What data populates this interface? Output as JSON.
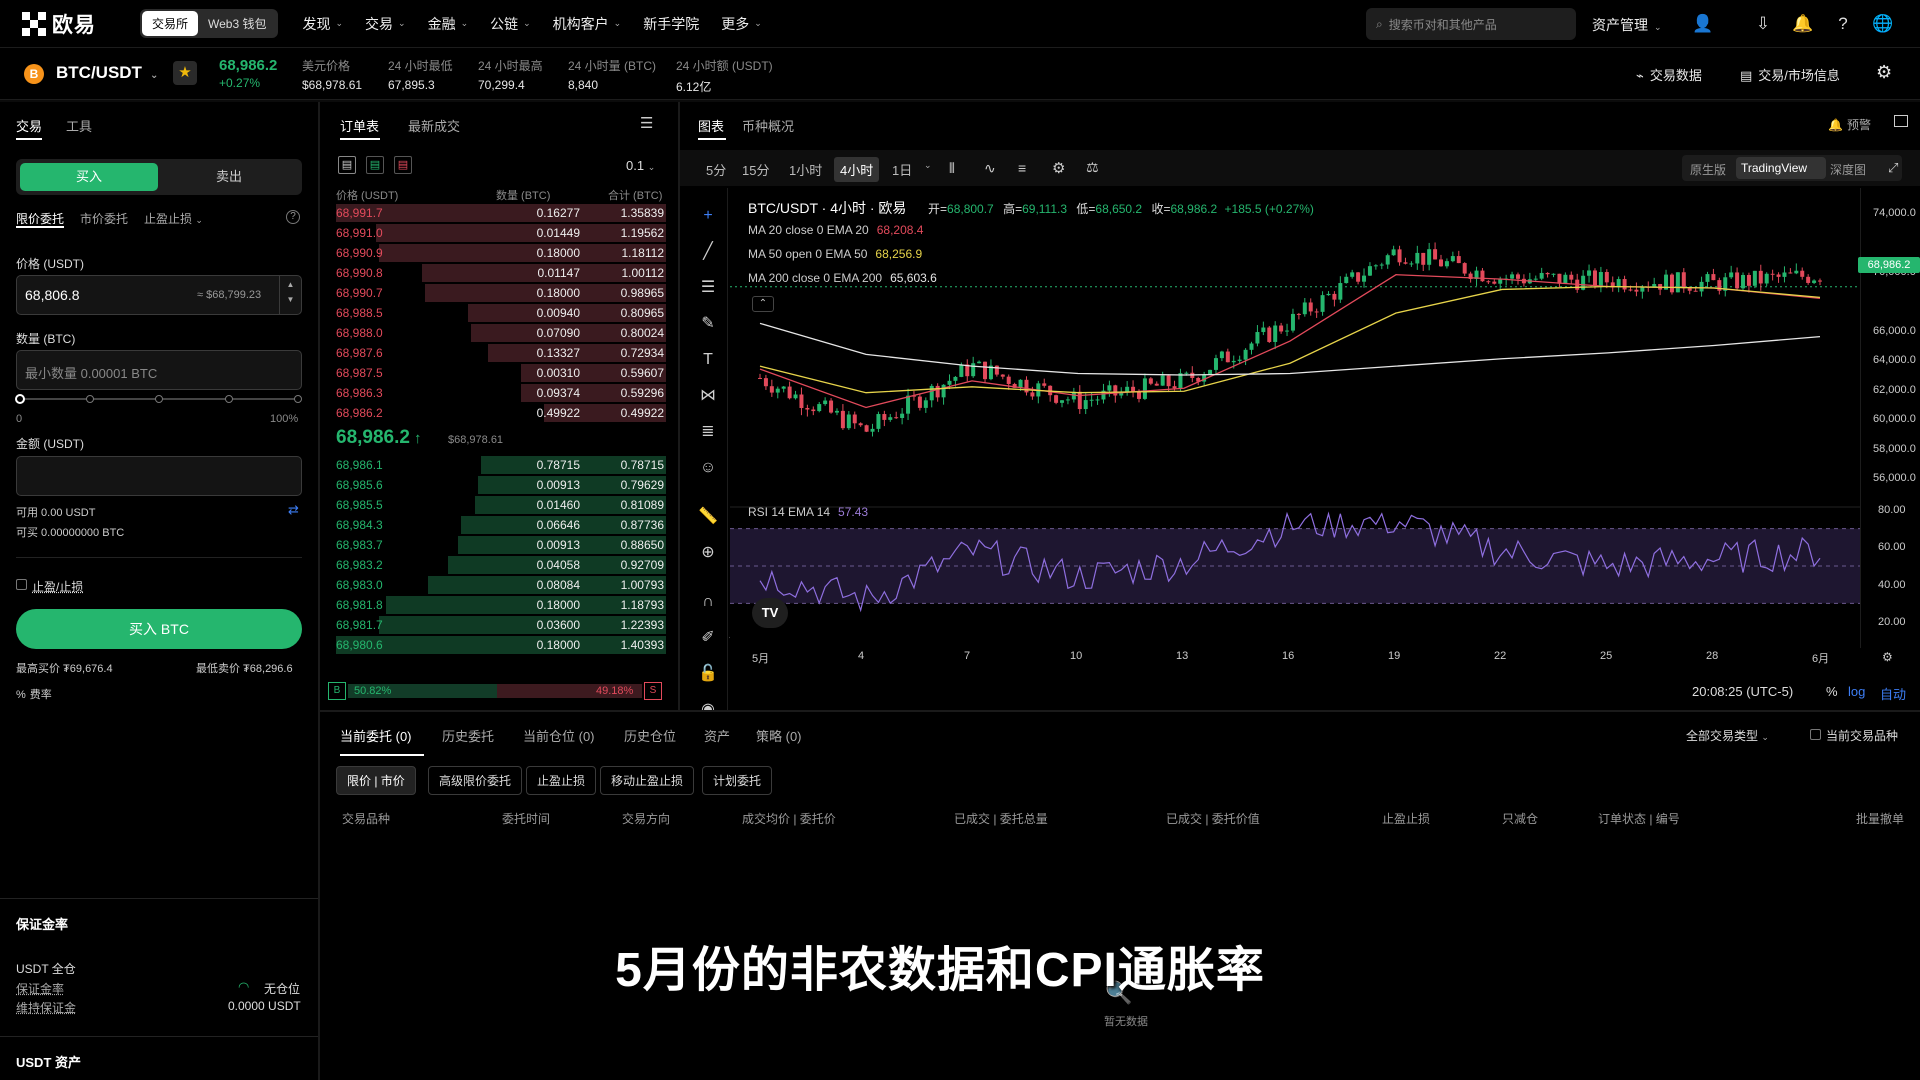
{
  "nav": {
    "brand": "欧易",
    "mode_tabs": [
      "交易所",
      "Web3 钱包"
    ],
    "menu": [
      "发现",
      "交易",
      "金融",
      "公链",
      "机构客户",
      "新手学院",
      "更多"
    ],
    "menu_has_chevron": [
      true,
      true,
      true,
      true,
      true,
      false,
      true
    ],
    "search_placeholder": "搜索币对和其他产品",
    "asset_menu": "资产管理"
  },
  "ticker": {
    "coin_letter": "B",
    "pair": "BTC/USDT",
    "price": "68,986.2",
    "change": "+0.27%",
    "stats": [
      {
        "label": "美元价格",
        "value": "$68,978.61"
      },
      {
        "label": "24 小时最低",
        "value": "67,895.3"
      },
      {
        "label": "24 小时最高",
        "value": "70,299.4"
      },
      {
        "label": "24 小时量 (BTC)",
        "value": "8,840"
      },
      {
        "label": "24 小时额 (USDT)",
        "value": "6.12亿"
      }
    ],
    "right_links": [
      "交易数据",
      "交易/市场信息"
    ]
  },
  "trade": {
    "tabs": [
      "交易",
      "工具"
    ],
    "side_buy": "买入",
    "side_sell": "卖出",
    "order_types": [
      "限价委托",
      "市价委托",
      "止盈止损"
    ],
    "price_label": "价格 (USDT)",
    "price_value": "68,806.8",
    "price_usd": "≈ $68,799.23",
    "qty_label": "数量 (BTC)",
    "qty_placeholder": "最小数量 0.00001 BTC",
    "slider_min": "0",
    "slider_max": "100%",
    "amount_label": "金额 (USDT)",
    "available": "可用 0.00 USDT",
    "can_buy": "可买 0.00000000 BTC",
    "tpsl": "止盈/止损",
    "buy_button": "买入 BTC",
    "max_buy": "最高买价 ₮69,676.4",
    "min_sell": "最低卖价 ₮68,296.6",
    "fee": "费率"
  },
  "margin": {
    "title": "保证金率",
    "account": "USDT 全仓",
    "ratio_label": "保证金率",
    "ratio_value": "无仓位",
    "maint_label": "维持保证金",
    "maint_value": "0.0000 USDT",
    "assets_title": "USDT 资产"
  },
  "orderbook": {
    "tabs": [
      "订单表",
      "最新成交"
    ],
    "precision": "0.1",
    "headers": [
      "价格 (USDT)",
      "数量 (BTC)",
      "合计 (BTC)"
    ],
    "asks": [
      [
        "68,991.7",
        "0.16277",
        "1.35839",
        1.0
      ],
      [
        "68,991.0",
        "0.01449",
        "1.19562",
        0.88
      ],
      [
        "68,990.9",
        "0.18000",
        "1.18112",
        0.87
      ],
      [
        "68,990.8",
        "0.01147",
        "1.00112",
        0.74
      ],
      [
        "68,990.7",
        "0.18000",
        "0.98965",
        0.73
      ],
      [
        "68,988.5",
        "0.00940",
        "0.80965",
        0.6
      ],
      [
        "68,988.0",
        "0.07090",
        "0.80024",
        0.59
      ],
      [
        "68,987.6",
        "0.13327",
        "0.72934",
        0.54
      ],
      [
        "68,987.5",
        "0.00310",
        "0.59607",
        0.44
      ],
      [
        "68,986.3",
        "0.09374",
        "0.59296",
        0.44
      ],
      [
        "68,986.2",
        "0.49922",
        "0.49922",
        0.37
      ]
    ],
    "mid_price": "68,986.2",
    "mid_usd": "$68,978.61",
    "bids": [
      [
        "68,986.1",
        "0.78715",
        "0.78715",
        0.56
      ],
      [
        "68,985.6",
        "0.00913",
        "0.79629",
        0.57
      ],
      [
        "68,985.5",
        "0.01460",
        "0.81089",
        0.58
      ],
      [
        "68,984.3",
        "0.06646",
        "0.87736",
        0.62
      ],
      [
        "68,983.7",
        "0.00913",
        "0.88650",
        0.63
      ],
      [
        "68,983.2",
        "0.04058",
        "0.92709",
        0.66
      ],
      [
        "68,983.0",
        "0.08084",
        "1.00793",
        0.72
      ],
      [
        "68,981.8",
        "0.18000",
        "1.18793",
        0.85
      ],
      [
        "68,981.7",
        "0.03600",
        "1.22393",
        0.87
      ],
      [
        "68,980.6",
        "0.18000",
        "1.40393",
        1.0
      ]
    ],
    "buy_ratio_label": "B",
    "buy_ratio": "50.82%",
    "sell_ratio": "49.18%",
    "sell_ratio_label": "S"
  },
  "chart": {
    "tabs": [
      "图表",
      "币种概况"
    ],
    "alert": "预警",
    "intervals": [
      "5分",
      "15分",
      "1小时",
      "4小时",
      "1日"
    ],
    "active_interval": "4小时",
    "views": [
      "原生版",
      "TradingView",
      "深度图"
    ],
    "legend_title": "BTC/USDT · 4小时 · 欧易",
    "ohlc": {
      "o_label": "开=",
      "o": "68,800.7",
      "h_label": "高=",
      "h": "69,111.3",
      "l_label": "低=",
      "l": "68,650.2",
      "c_label": "收=",
      "c": "68,986.2",
      "chg": "+185.5 (+0.27%)"
    },
    "ma": [
      {
        "label": "MA 20 close 0 EMA 20",
        "value": "68,208.4",
        "color": "#e24a5b"
      },
      {
        "label": "MA 50 open 0 EMA 50",
        "value": "68,256.9",
        "color": "#e6d34a"
      },
      {
        "label": "MA 200 close 0 EMA 200",
        "value": "65,603.6",
        "color": "#e6e6e6"
      }
    ],
    "rsi_label": "RSI 14 EMA 14",
    "rsi_value": "57.43",
    "price_ticks": [
      "74,000.0",
      "70,000.0",
      "66,000.0",
      "64,000.0",
      "62,000.0",
      "60,000.0",
      "58,000.0",
      "56,000.0"
    ],
    "last_price_tag": "68,986.2",
    "rsi_ticks": [
      "80.00",
      "60.00",
      "40.00",
      "20.00"
    ],
    "date_ticks": [
      "5月",
      "4",
      "7",
      "10",
      "13",
      "16",
      "19",
      "22",
      "25",
      "28",
      "6月"
    ],
    "clock": "20:08:25 (UTC-5)",
    "pct": "%",
    "log": "log",
    "auto": "自动"
  },
  "chart_data": {
    "type": "line",
    "title": "BTC/USDT · 4小时 · 欧易",
    "x": [
      "5月",
      "4",
      "7",
      "10",
      "13",
      "16",
      "19",
      "22",
      "25",
      "28",
      "6月"
    ],
    "series": [
      {
        "name": "BTC/USDT",
        "values": [
          62800,
          59200,
          63600,
          61200,
          62600,
          66600,
          71400,
          69600,
          69400,
          69200,
          69800
        ]
      },
      {
        "name": "MA 20 close 0 EMA 20",
        "values": [
          63400,
          60800,
          62600,
          61600,
          62100,
          65300,
          69800,
          69500,
          69000,
          68900,
          68200
        ]
      },
      {
        "name": "MA 50 open 0 EMA 50",
        "values": [
          63600,
          61800,
          62200,
          61800,
          61900,
          63800,
          67200,
          68800,
          69000,
          68900,
          68260
        ]
      },
      {
        "name": "MA 200 close 0 EMA 200",
        "values": [
          66500,
          64400,
          63600,
          63100,
          63000,
          63100,
          63600,
          64100,
          64500,
          65000,
          65600
        ]
      }
    ],
    "ylim": [
      55000,
      75000
    ],
    "rsi": {
      "name": "RSI 14 EMA 14",
      "values": [
        45,
        32,
        58,
        44,
        52,
        72,
        74,
        58,
        50,
        54,
        57.43
      ],
      "ylim": [
        20,
        80
      ]
    }
  },
  "orders": {
    "tabs": [
      "当前委托 (0)",
      "历史委托",
      "当前仓位 (0)",
      "历史仓位",
      "资产",
      "策略 (0)"
    ],
    "filter": "全部交易类型",
    "current_only": "当前交易品种",
    "subtabs": [
      "限价 | 市价",
      "高级限价委托",
      "止盈止损",
      "移动止盈止损",
      "计划委托"
    ],
    "columns": [
      "交易品种",
      "委托时间",
      "交易方向",
      "成交均价 | 委托价",
      "已成交 | 委托总量",
      "已成交 | 委托价值",
      "止盈止损",
      "只减仓",
      "订单状态 | 编号",
      "批量撤单"
    ],
    "empty": "暂无数据"
  },
  "subtitle": "5月份的非农数据和CPI通胀率"
}
